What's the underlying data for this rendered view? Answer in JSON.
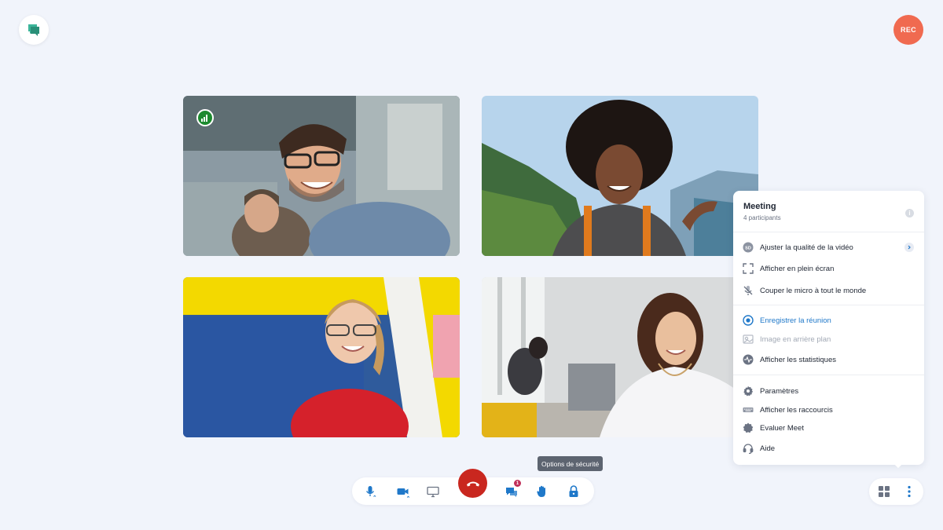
{
  "header": {
    "logo_icon": "chat-logo-icon",
    "rec_label": "REC",
    "rec_color": "#f06a50"
  },
  "tiles": [
    {
      "scene": "two men smiling in office",
      "signal_icon": "signal-strength-icon"
    },
    {
      "scene": "woman with curly hair in mountains"
    },
    {
      "scene": "smiling girl with glasses in red sweater"
    },
    {
      "scene": "young woman writing at desk"
    }
  ],
  "menu": {
    "title": "Meeting",
    "subtitle": "4 participants",
    "info_glyph": "i",
    "groups": [
      [
        {
          "label": "Ajuster la qualité de la vidéo",
          "icon": "sd-quality-icon",
          "has_chevron": true
        },
        {
          "label": "Afficher en plein écran",
          "icon": "fullscreen-icon"
        },
        {
          "label": "Couper le micro à tout le monde",
          "icon": "mic-off-icon"
        }
      ],
      [
        {
          "label": "Enregistrer la réunion",
          "icon": "record-icon",
          "active": true
        },
        {
          "label": "Image en arrière plan",
          "icon": "background-image-icon",
          "disabled": true
        },
        {
          "label": "Afficher les statistiques",
          "icon": "stats-icon"
        }
      ],
      [
        {
          "label": "Paramètres",
          "icon": "gear-icon"
        },
        {
          "label": "Afficher les raccourcis",
          "icon": "keyboard-icon"
        },
        {
          "label": "Evaluer Meet",
          "icon": "star-badge-icon"
        },
        {
          "label": "Aide",
          "icon": "headset-icon"
        }
      ]
    ]
  },
  "tooltip": "Options de sécurité",
  "toolbar": {
    "items": [
      "mic-icon",
      "camera-icon",
      "screen-share-icon",
      "hangup-icon",
      "chat-icon",
      "raise-hand-icon",
      "lock-icon"
    ],
    "chat_badge": "1",
    "accent": "#1f78c9",
    "hangup_color": "#c9271f"
  },
  "right_controls": [
    "grid-view-icon",
    "more-vertical-icon"
  ]
}
